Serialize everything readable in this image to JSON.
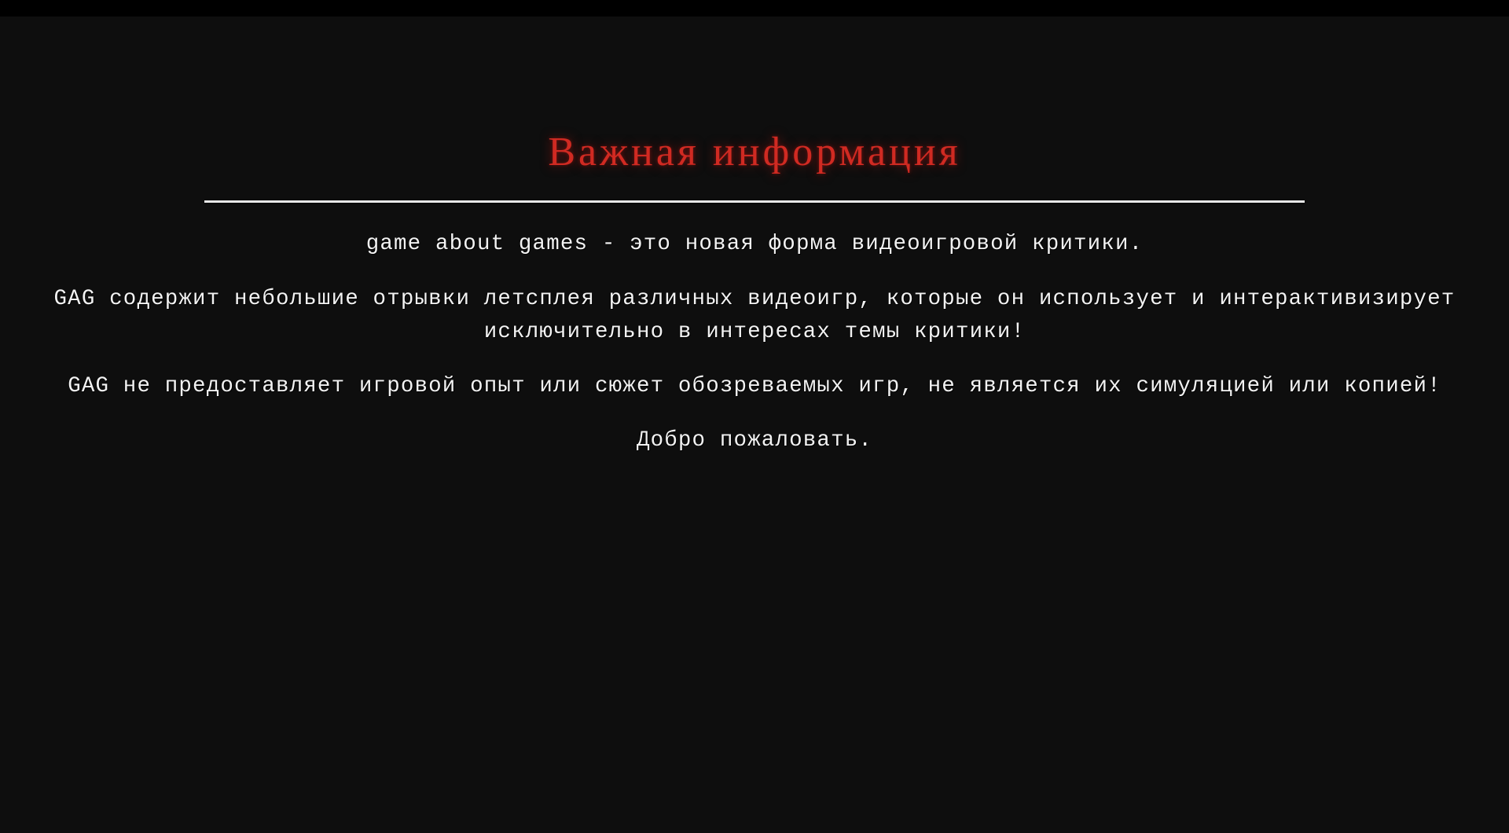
{
  "screen": {
    "background_color": "#0e0e0e",
    "letterbox_color": "#000000"
  },
  "panel": {
    "title": "Важная информация",
    "title_color": "#d02a22",
    "divider_color": "#e8e8e8",
    "body_color": "#f2f2f2",
    "paragraphs": [
      "game about games - это новая форма видеоигровой критики.",
      "GAG содержит небольшие отрывки летсплея различных видеоигр, которые он использует и интерактивизирует исключительно в интересах темы критики!",
      "GAG не предоставляет игровой опыт или сюжет обозреваемых игр, не является их симуляцией или копией!",
      "Добро пожаловать."
    ]
  }
}
